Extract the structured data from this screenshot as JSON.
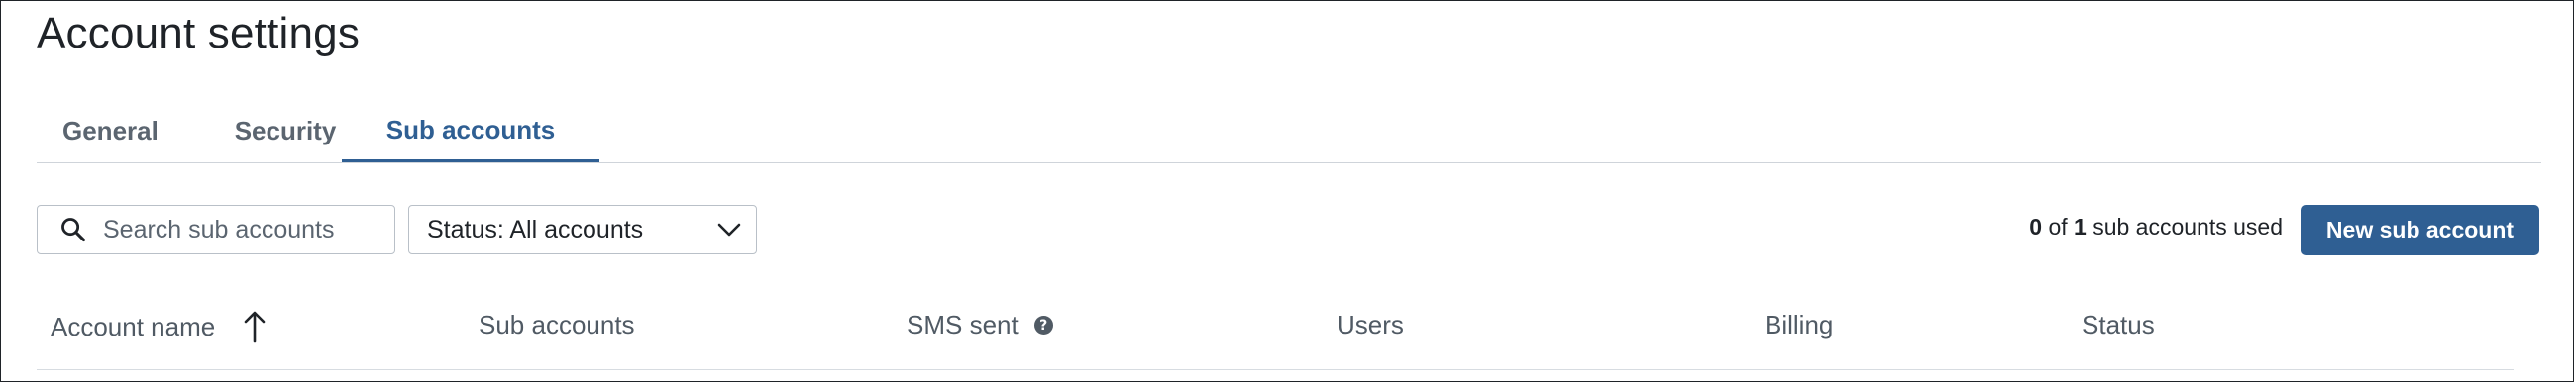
{
  "page": {
    "title": "Account settings"
  },
  "tabs": [
    {
      "label": "General",
      "active": false
    },
    {
      "label": "Security",
      "active": false
    },
    {
      "label": "Sub accounts",
      "active": true
    }
  ],
  "toolbar": {
    "search_placeholder": "Search sub accounts",
    "search_icon": "search-icon",
    "status_filter": {
      "selected": "Status: All accounts",
      "icon": "chevron-down-icon"
    },
    "usage": {
      "used": "0",
      "of_text": "of",
      "total": "1",
      "suffix": "sub accounts used"
    },
    "new_button_label": "New sub account"
  },
  "table": {
    "columns": [
      {
        "label": "Account name",
        "sort": "ascending",
        "icon": "sort-up-arrow-icon"
      },
      {
        "label": "Sub accounts"
      },
      {
        "label": "SMS sent",
        "icon": "help-icon"
      },
      {
        "label": "Users"
      },
      {
        "label": "Billing"
      },
      {
        "label": "Status"
      }
    ],
    "rows": []
  },
  "colors": {
    "accent": "#2f5f93",
    "text": "#1f2328",
    "muted": "#5b6570",
    "border": "#b9c0c8",
    "divider": "#cfd4da"
  }
}
